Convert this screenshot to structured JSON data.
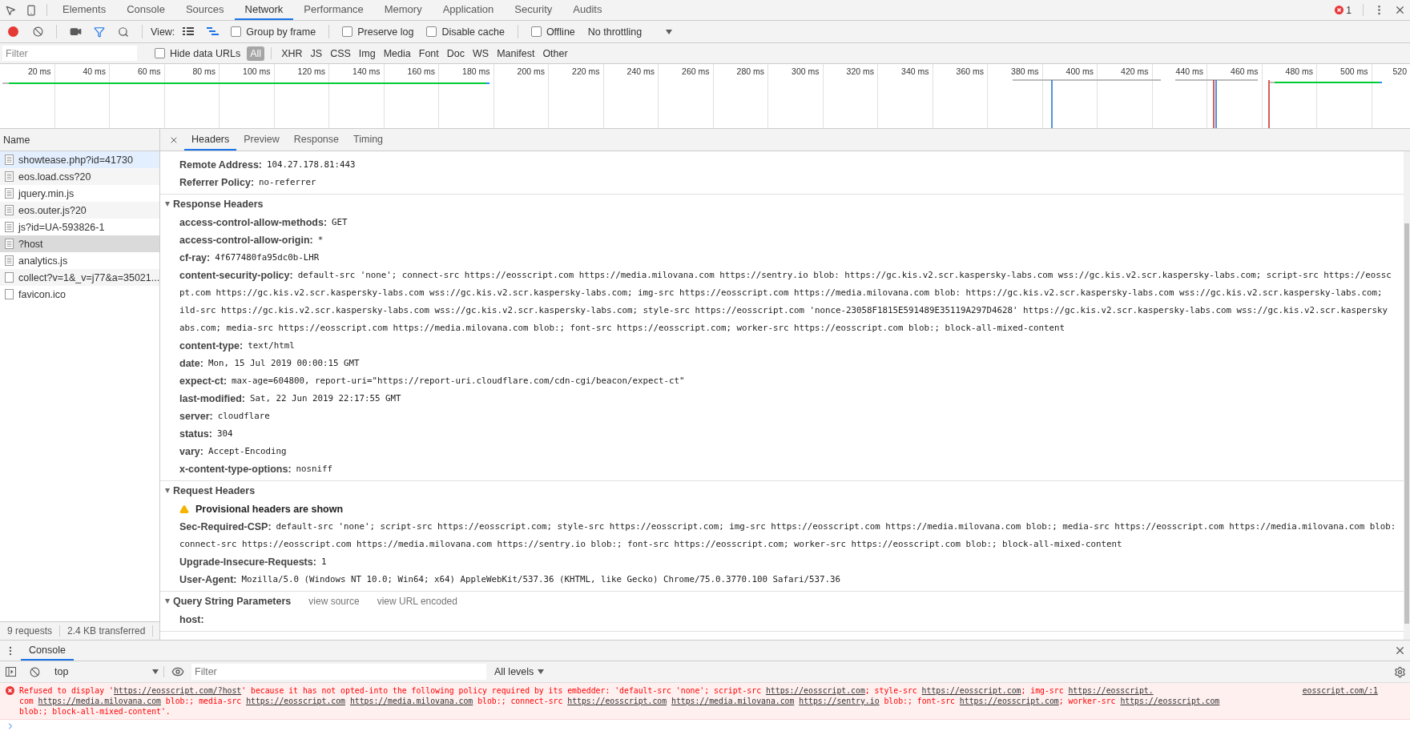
{
  "devtools_tabs": [
    {
      "label": "Elements",
      "selected": false
    },
    {
      "label": "Console",
      "selected": false
    },
    {
      "label": "Sources",
      "selected": false
    },
    {
      "label": "Network",
      "selected": true
    },
    {
      "label": "Performance",
      "selected": false
    },
    {
      "label": "Memory",
      "selected": false
    },
    {
      "label": "Application",
      "selected": false
    },
    {
      "label": "Security",
      "selected": false
    },
    {
      "label": "Audits",
      "selected": false
    }
  ],
  "error_count": "1",
  "network_toolbar": {
    "recording": true,
    "view_label": "View:",
    "options": [
      {
        "label": "Group by frame",
        "checked": false
      },
      {
        "label": "Preserve log",
        "checked": false
      },
      {
        "label": "Disable cache",
        "checked": false
      },
      {
        "label": "Offline",
        "checked": false
      }
    ],
    "throttling": "No throttling"
  },
  "filter_bar": {
    "placeholder": "Filter",
    "hide_data_urls": {
      "label": "Hide data URLs",
      "checked": false
    },
    "types": [
      {
        "label": "All",
        "selected": true
      },
      {
        "label": "XHR",
        "selected": false
      },
      {
        "label": "JS",
        "selected": false
      },
      {
        "label": "CSS",
        "selected": false
      },
      {
        "label": "Img",
        "selected": false
      },
      {
        "label": "Media",
        "selected": false
      },
      {
        "label": "Font",
        "selected": false
      },
      {
        "label": "Doc",
        "selected": false
      },
      {
        "label": "WS",
        "selected": false
      },
      {
        "label": "Manifest",
        "selected": false
      },
      {
        "label": "Other",
        "selected": false
      }
    ]
  },
  "overview": {
    "ticks": [
      "20 ms",
      "40 ms",
      "60 ms",
      "80 ms",
      "100 ms",
      "120 ms",
      "140 ms",
      "160 ms",
      "180 ms",
      "200 ms",
      "220 ms",
      "240 ms",
      "260 ms",
      "280 ms",
      "300 ms",
      "320 ms",
      "340 ms",
      "360 ms",
      "380 ms",
      "400 ms",
      "420 ms",
      "440 ms",
      "460 ms",
      "480 ms",
      "500 ms",
      "520"
    ]
  },
  "requests": {
    "column": "Name",
    "rows": [
      {
        "name": "showtease.php?id=41730",
        "kind": "document",
        "hovered": true,
        "selected": false
      },
      {
        "name": "eos.load.css?20",
        "kind": "document",
        "hovered": false,
        "selected": false
      },
      {
        "name": "jquery.min.js",
        "kind": "document",
        "hovered": false,
        "selected": false
      },
      {
        "name": "eos.outer.js?20",
        "kind": "document",
        "hovered": false,
        "selected": false
      },
      {
        "name": "js?id=UA-593826-1",
        "kind": "document",
        "hovered": false,
        "selected": false
      },
      {
        "name": "?host",
        "kind": "document",
        "hovered": false,
        "selected": true
      },
      {
        "name": "analytics.js",
        "kind": "document",
        "hovered": false,
        "selected": false
      },
      {
        "name": "collect?v=1&_v=j77&a=35021...",
        "kind": "blank",
        "hovered": false,
        "selected": false
      },
      {
        "name": "favicon.ico",
        "kind": "blank",
        "hovered": false,
        "selected": false
      }
    ],
    "summary": [
      "9 requests",
      "2.4 KB transferred"
    ]
  },
  "detail": {
    "tabs": [
      {
        "label": "Headers",
        "selected": true
      },
      {
        "label": "Preview",
        "selected": false
      },
      {
        "label": "Response",
        "selected": false
      },
      {
        "label": "Timing",
        "selected": false
      }
    ],
    "general": [
      {
        "key": "Remote Address:",
        "value_lines": [
          "104.27.178.81:443"
        ]
      },
      {
        "key": "Referrer Policy:",
        "value_lines": [
          "no-referrer"
        ]
      }
    ],
    "sections": [
      {
        "title": "Response Headers",
        "expanded": true,
        "headers": [
          {
            "key": "access-control-allow-methods:",
            "value_lines": [
              "GET"
            ]
          },
          {
            "key": "access-control-allow-origin:",
            "value_lines": [
              "*"
            ]
          },
          {
            "key": "cf-ray:",
            "value_lines": [
              "4f677480fa95dc0b-LHR"
            ]
          },
          {
            "key": "content-security-policy:",
            "value_lines": [
              "default-src 'none'; connect-src https://eosscript.com https://media.milovana.com https://sentry.io blob: https://gc.kis.v2.scr.kaspersky-labs.com wss://gc.kis.v2.scr.kaspersky-labs.com; script-src https://eossc",
              "pt.com https://gc.kis.v2.scr.kaspersky-labs.com wss://gc.kis.v2.scr.kaspersky-labs.com; img-src https://eosscript.com https://media.milovana.com blob: https://gc.kis.v2.scr.kaspersky-labs.com wss://gc.kis.v2.scr.kaspersky-labs.com;",
              "ild-src https://gc.kis.v2.scr.kaspersky-labs.com wss://gc.kis.v2.scr.kaspersky-labs.com; style-src https://eosscript.com 'nonce-23058F1815E591489E35119A297D4628' https://gc.kis.v2.scr.kaspersky-labs.com wss://gc.kis.v2.scr.kaspersky",
              "abs.com; media-src https://eosscript.com https://media.milovana.com blob:; font-src https://eosscript.com; worker-src https://eosscript.com blob:; block-all-mixed-content"
            ]
          },
          {
            "key": "content-type:",
            "value_lines": [
              "text/html"
            ]
          },
          {
            "key": "date:",
            "value_lines": [
              "Mon, 15 Jul 2019 00:00:15 GMT"
            ]
          },
          {
            "key": "expect-ct:",
            "value_lines": [
              "max-age=604800, report-uri=\"https://report-uri.cloudflare.com/cdn-cgi/beacon/expect-ct\""
            ]
          },
          {
            "key": "last-modified:",
            "value_lines": [
              "Sat, 22 Jun 2019 22:17:55 GMT"
            ]
          },
          {
            "key": "server:",
            "value_lines": [
              "cloudflare"
            ]
          },
          {
            "key": "status:",
            "value_lines": [
              "304"
            ]
          },
          {
            "key": "vary:",
            "value_lines": [
              "Accept-Encoding"
            ]
          },
          {
            "key": "x-content-type-options:",
            "value_lines": [
              "nosniff"
            ]
          }
        ]
      },
      {
        "title": "Request Headers",
        "expanded": true,
        "warning": "Provisional headers are shown",
        "headers": [
          {
            "key": "Sec-Required-CSP:",
            "value_lines": [
              "default-src 'none'; script-src https://eosscript.com; style-src https://eosscript.com; img-src https://eosscript.com https://media.milovana.com blob:; media-src https://eosscript.com https://media.milovana.com blob:",
              "connect-src https://eosscript.com https://media.milovana.com https://sentry.io blob:; font-src https://eosscript.com; worker-src https://eosscript.com blob:; block-all-mixed-content"
            ]
          },
          {
            "key": "Upgrade-Insecure-Requests:",
            "value_lines": [
              "1"
            ]
          },
          {
            "key": "User-Agent:",
            "value_lines": [
              "Mozilla/5.0 (Windows NT 10.0; Win64; x64) AppleWebKit/537.36 (KHTML, like Gecko) Chrome/75.0.3770.100 Safari/537.36"
            ]
          }
        ]
      },
      {
        "title": "Query String Parameters",
        "expanded": true,
        "actions": [
          "view source",
          "view URL encoded"
        ],
        "headers": [
          {
            "key": "host:"
          }
        ]
      }
    ]
  },
  "console": {
    "tab": "Console",
    "context": "top",
    "filter_placeholder": "Filter",
    "levels": "All levels",
    "messages": [
      {
        "kind": "error",
        "source": "eosscript.com/:1",
        "lines": [
          [
            {
              "kind": "text",
              "text": "Refused to display '"
            },
            {
              "kind": "link",
              "text": "https://eosscript.com/?host"
            },
            {
              "kind": "text",
              "text": "' because it has not opted-into the following policy required by its embedder: 'default-src 'none'; script-src "
            },
            {
              "kind": "link",
              "text": "https://eosscript.com"
            },
            {
              "kind": "text",
              "text": "; style-src "
            },
            {
              "kind": "link",
              "text": "https://eosscript.com"
            },
            {
              "kind": "text",
              "text": "; img-src "
            },
            {
              "kind": "link",
              "text": "https://eosscript."
            }
          ],
          [
            {
              "kind": "text",
              "text": "com "
            },
            {
              "kind": "link",
              "text": "https://media.milovana.com"
            },
            {
              "kind": "text",
              "text": " blob:; media-src "
            },
            {
              "kind": "link",
              "text": "https://eosscript.com"
            },
            {
              "kind": "link",
              "text": "https://media.milovana.com"
            },
            {
              "kind": "text",
              "text": " blob:; connect-src "
            },
            {
              "kind": "link",
              "text": "https://eosscript.com"
            },
            {
              "kind": "link",
              "text": "https://media.milovana.com"
            },
            {
              "kind": "link",
              "text": "https://sentry.io"
            },
            {
              "kind": "text",
              "text": " blob:; font-src "
            },
            {
              "kind": "link",
              "text": "https://eosscript.com"
            },
            {
              "kind": "text",
              "text": "; worker-src "
            },
            {
              "kind": "link",
              "text": "https://eosscript.com"
            }
          ],
          [
            {
              "kind": "text",
              "text": "blob:; block-all-mixed-content'."
            }
          ]
        ]
      }
    ]
  }
}
